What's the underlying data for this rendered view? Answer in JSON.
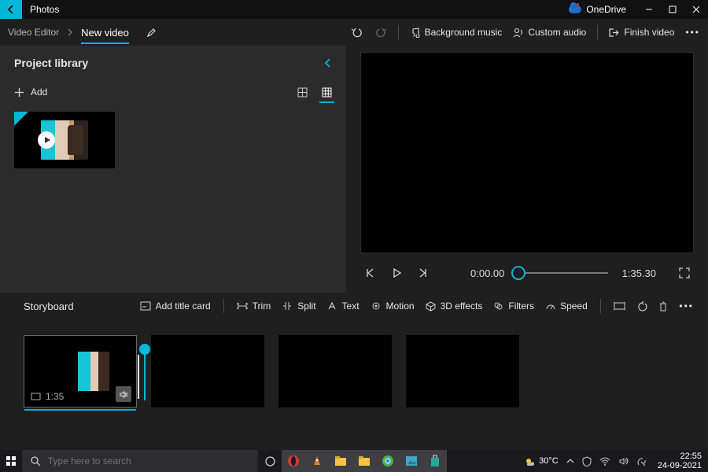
{
  "titlebar": {
    "app_name": "Photos",
    "onedrive_label": "OneDrive"
  },
  "breadcrumb": {
    "root": "Video Editor",
    "current": "New video"
  },
  "toolbar": {
    "bg_music": "Background music",
    "custom_audio": "Custom audio",
    "finish": "Finish video"
  },
  "library": {
    "title": "Project library",
    "add_label": "Add"
  },
  "preview": {
    "current_time": "0:00.00",
    "total_time": "1:35.30"
  },
  "storyboard": {
    "title": "Storyboard",
    "add_title_card": "Add title card",
    "trim": "Trim",
    "split": "Split",
    "text": "Text",
    "motion": "Motion",
    "three_d": "3D effects",
    "filters": "Filters",
    "speed": "Speed",
    "clip_duration": "1:35"
  },
  "taskbar": {
    "search_placeholder": "Type here to search",
    "temp": "30°C",
    "time": "22:55",
    "date": "24-09-2021"
  }
}
